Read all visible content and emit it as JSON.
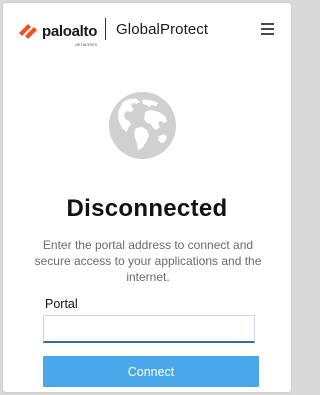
{
  "header": {
    "brand": "paloalto",
    "brand_sub": "NETWORKS",
    "product": "GlobalProtect",
    "menu_icon": "hamburger-menu-icon"
  },
  "colors": {
    "brand_orange": "#f04e23",
    "accent": "#4aa8ea",
    "globe": "#cfcfcf"
  },
  "main": {
    "status_icon": "globe-icon",
    "status": "Disconnected",
    "description": "Enter the portal address to connect and secure access to your applications and the internet."
  },
  "form": {
    "portal_label": "Portal",
    "portal_value": "",
    "connect_label": "Connect"
  }
}
